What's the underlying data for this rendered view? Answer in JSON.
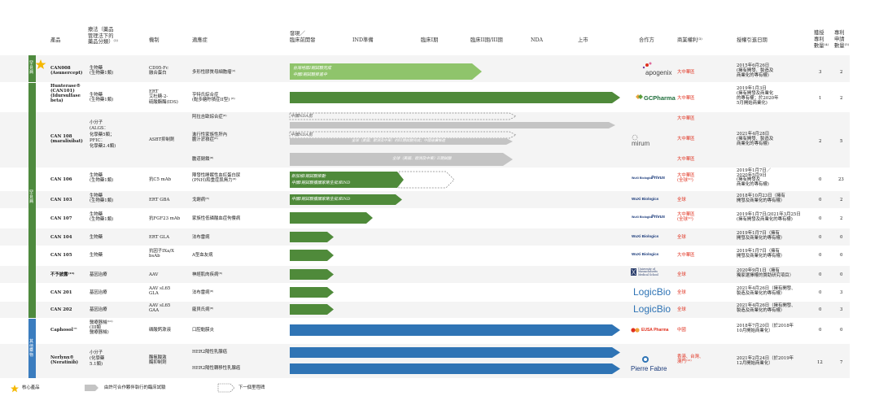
{
  "header": {
    "product": "產品",
    "therapy": [
      "療法（藥品",
      "管理法下的",
      "藥品分類）⁽¹⁾"
    ],
    "mechanism": "機制",
    "indication": "適應症",
    "discovery": [
      "發現／",
      "臨床前開發"
    ],
    "ind_prep": "IND準備",
    "phase1": "臨床I期",
    "phase23": "臨床II期/III期",
    "nda": "NDA",
    "launch": "上市",
    "partner": "合作方",
    "commercial_rights": "商業權利⁽³⁾",
    "license_date": "授權引進日期",
    "granted_patents": [
      "獲授",
      "專利",
      "數量⁽⁴⁾"
    ],
    "applied_patents": [
      "專利",
      "申請",
      "數量⁽⁵⁾"
    ]
  },
  "groups": {
    "rare_disease_1": "罕見病",
    "rare_disease_2": "罕見病",
    "other": "其他藥物"
  },
  "rows": [
    {
      "product": [
        "CAN008",
        "(Asunercept)"
      ],
      "therapy": [
        "生物藥",
        "(生物藥1類)"
      ],
      "mechanism": [
        "CD95-Fc",
        "融合蛋白"
      ],
      "indication": [
        "多形性膠質母細胞瘤⁽²⁾"
      ],
      "arrow_text": [
        "台灣地區I期試驗完成",
        "中國I期試驗推進中"
      ],
      "partner": "apogenix",
      "rights": "大中華區",
      "date": [
        "2015年6月26日",
        "(擁有開發、製造及",
        "商業化的專有權)"
      ],
      "granted": "3",
      "applied": "2"
    },
    {
      "product": [
        "Hunterase®",
        "(CAN101)",
        "(Idursulfase",
        "beta)"
      ],
      "therapy": [
        "生物藥",
        "(生物藥1類)"
      ],
      "mechanism": [
        "ERT",
        "艾杜糖-2-",
        "硫酸酯酶(IDS)"
      ],
      "indication": [
        "亨特氏綜合症",
        "(黏多糖貯積症II型) ⁽⁶⁾"
      ],
      "partner": "GCPharma",
      "rights": "大中華區",
      "date": [
        "2019年1月3日",
        "(擁有開發及商業化",
        "的專有權；於2020年",
        "5月開始商業化)"
      ],
      "granted": "1",
      "applied": "2"
    },
    {
      "product": [
        "CAN 108",
        "(maralixibat)"
      ],
      "therapy": [
        "小分子",
        "(ALGS：",
        "化學藥5類；",
        "PFIC：",
        "化學藥2.4類)"
      ],
      "mechanism": [
        "ASBT抑制劑"
      ],
      "indications": [
        {
          "name": [
            "阿拉吉歐綜合症⁽⁸⁾"
          ],
          "arrow_text": "中國NDA前",
          "rights": "大中華區"
        },
        {
          "name": [
            "進行性家族性肝內",
            "膽汁淤積症⁽⁸⁾"
          ],
          "arrow_text": "中國NDA前",
          "sub_text": "全球（美國、歐洲及中東）的III期試驗完成；中國後續推進",
          "rights": "大中華區"
        },
        {
          "name": [
            "膽道閉鎖⁽⁸⁾"
          ],
          "arrow_text": "全球（美國、歐洲及中東）II期試驗",
          "rights": "大中華區"
        }
      ],
      "partner": "mirum",
      "date": [
        "2021年4月28日",
        "(擁有開發、製造及",
        "商業化的專有權)"
      ],
      "granted": "2",
      "applied": "5"
    },
    {
      "product": [
        "CAN 106"
      ],
      "therapy": [
        "生物藥",
        "(生物藥1類)"
      ],
      "mechanism": [
        "抗C5 mAb"
      ],
      "indication": [
        "陣發性睡眠性血紅蛋白尿",
        "(PNH)和重症肌無力⁽⁸⁾"
      ],
      "arrow_text": [
        "新加坡I期試驗推動",
        "中國I期試驗獲國家衛生批准IND"
      ],
      "partner": [
        "WuXi Biologics",
        "Privus"
      ],
      "rights": [
        "大中華區",
        "(全球⁽⁹⁾)"
      ],
      "date": [
        "2019年1月7日／",
        "2020年5月9日",
        "(擁有開發及",
        "商業化的專有權)"
      ],
      "granted": "0",
      "applied": "23"
    },
    {
      "product": [
        "CAN 103"
      ],
      "therapy": [
        "生物藥",
        "(生物藥1類)"
      ],
      "mechanism": [
        "ERT GBA"
      ],
      "indication": [
        "戈謝病⁽⁸⁾"
      ],
      "arrow_text": [
        "中國I期試驗獲國家衛生批准IND"
      ],
      "partner": "WuXi Biologics",
      "rights": "全球",
      "date": [
        "2018年10月23日（擁有",
        "開發及商業化的專有權）"
      ],
      "granted": "0",
      "applied": "2"
    },
    {
      "product": [
        "CAN 107"
      ],
      "therapy": [
        "生物藥",
        "(生物藥1類)"
      ],
      "mechanism": [
        "抗FGF23 mAb"
      ],
      "indication": [
        "家族性低磷酸血症佝僂病"
      ],
      "partner": [
        "WuXi Biologics",
        "Privus"
      ],
      "rights": [
        "大中華區",
        "(全球⁽⁹⁾)"
      ],
      "date": [
        "2019年1月7日/2021年3月25日",
        "(擁有開發及商業化的專有權)"
      ],
      "granted": "0",
      "applied": "2"
    },
    {
      "product": [
        "CAN 104"
      ],
      "therapy": [
        "生物藥"
      ],
      "mechanism": [
        "ERT GLA"
      ],
      "indication": [
        "法布雷病"
      ],
      "partner": "WuXi Biologics",
      "rights": "全球",
      "date": [
        "2019年1月7日（擁有",
        "開發及商業化的專有權）"
      ],
      "granted": "0",
      "applied": "0"
    },
    {
      "product": [
        "CAN 105"
      ],
      "therapy": [
        "生物藥"
      ],
      "mechanism": [
        "抗因子IXa/X",
        "bsAb"
      ],
      "indication": [
        "A型血友病"
      ],
      "partner": "WuXi Biologics",
      "rights": "大中華區",
      "date": [
        "2019年1月7日（擁有",
        "開發及商業化的專有權）"
      ],
      "granted": "0",
      "applied": "0"
    },
    {
      "product": [
        "不予披露⁽¹⁰⁾"
      ],
      "therapy": [
        "基因治療"
      ],
      "mechanism": [
        "AAV"
      ],
      "indication": [
        "神經肌肉疾病⁽⁸⁾"
      ],
      "partner": [
        "University of",
        "Massachusetts",
        "Medical School"
      ],
      "rights": "全球",
      "date": [
        "2020年9月1日（擁有",
        "獨家選擇權的贊助研究項目）"
      ],
      "granted": "0",
      "applied": "0"
    },
    {
      "product": [
        "CAN 201"
      ],
      "therapy": [
        "基因治療"
      ],
      "mechanism": [
        "AAV sL65",
        "GLA"
      ],
      "indication": [
        "法布雷病⁽⁸⁾"
      ],
      "partner": "LogicBio",
      "rights": "全球",
      "date": [
        "2021年4月26日（擁有開發、",
        "製造及商業化的專有權）"
      ],
      "granted": "0",
      "applied": "3"
    },
    {
      "product": [
        "CAN 202"
      ],
      "therapy": [
        "基因治療"
      ],
      "mechanism": [
        "AAV sL65",
        "GAA"
      ],
      "indication": [
        "龐貝氏病⁽⁸⁾"
      ],
      "partner": "LogicBio",
      "rights": "全球",
      "date": [
        "2021年4月26日（擁有開發、",
        "製造及商業化的專有權）"
      ],
      "granted": "0",
      "applied": "3"
    },
    {
      "product": [
        "Caphosol™"
      ],
      "therapy": [
        "醫療器械⁽¹¹⁾",
        "(III類",
        "醫療器械)"
      ],
      "mechanism": [
        "磷酸鈣漱液"
      ],
      "indication": [
        "口腔黏膜炎"
      ],
      "partner": "EUSA Pharma",
      "rights": "中國",
      "date": [
        "2018年7月20日（於2018年",
        "10月開始商業化）"
      ],
      "granted": "0",
      "applied": "0"
    },
    {
      "product": [
        "Nerlynx®",
        "(Neratinib)"
      ],
      "therapy": [
        "小分子",
        "(化學藥",
        "5.1類)"
      ],
      "mechanism": [
        "酪氨酸激",
        "酶抑制劑"
      ],
      "indications": [
        {
          "name": [
            "HER2陽性乳腺癌"
          ]
        },
        {
          "name": [
            "HER2陽性轉移性乳腺癌"
          ]
        }
      ],
      "partner": "Pierre Fabre",
      "rights": [
        "香港、台灣、",
        "澳門⁽¹²⁾"
      ],
      "date": [
        "2021年2月24日（於2019年",
        "12月開始商業化）"
      ],
      "granted": "12",
      "applied": "7"
    }
  ],
  "legend": {
    "core": "核心產品",
    "partner_trial": "由許可合作夥伴執行的臨床試驗",
    "next_milestone": "下一個里程碑"
  },
  "colors": {
    "green": "#4f8a3a",
    "green_light": "#8fc46b",
    "blue": "#2f74b5",
    "gray": "#c4c4c4",
    "red": "#e0301e",
    "sidebar_green": "#4e8a3e",
    "sidebar_blue": "#3b7dbf",
    "star": "#f5b800"
  }
}
